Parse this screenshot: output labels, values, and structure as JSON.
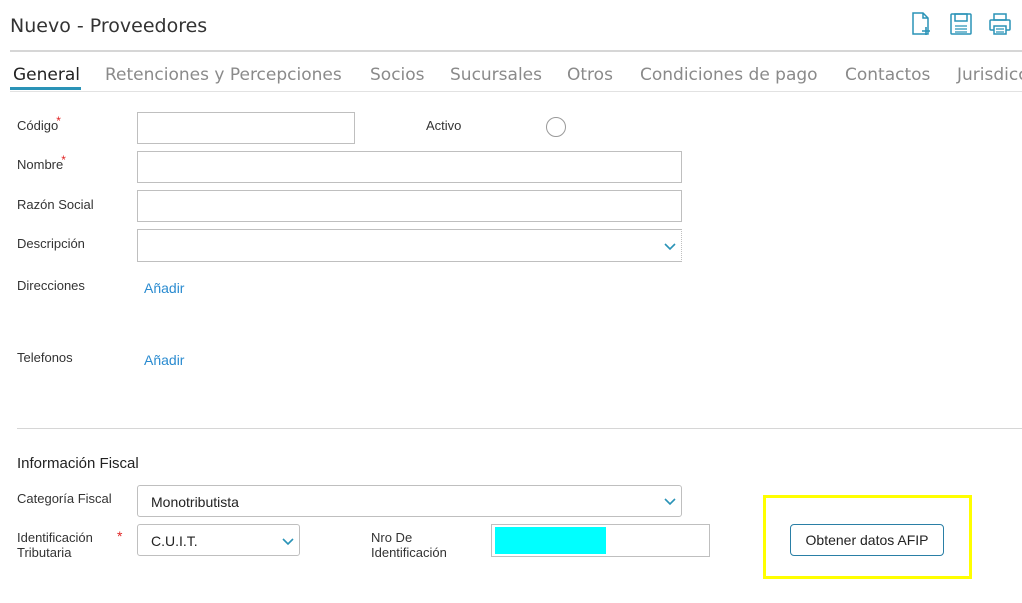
{
  "header": {
    "title": "Nuevo - Proveedores"
  },
  "toolbar": {
    "new_icon": "new-document-icon",
    "save_icon": "save-icon",
    "print_icon": "print-icon"
  },
  "tabs": [
    {
      "label": "General",
      "active": true
    },
    {
      "label": "Retenciones y Percepciones"
    },
    {
      "label": "Socios"
    },
    {
      "label": "Sucursales"
    },
    {
      "label": "Otros"
    },
    {
      "label": "Condiciones de pago"
    },
    {
      "label": "Contactos"
    },
    {
      "label": "Jurisdicciones"
    }
  ],
  "form": {
    "codigo": {
      "label": "Código",
      "required": "*",
      "value": ""
    },
    "activo": {
      "label": "Activo"
    },
    "nombre": {
      "label": "Nombre",
      "required": "*",
      "value": ""
    },
    "razon_social": {
      "label": "Razón Social",
      "value": ""
    },
    "descripcion": {
      "label": "Descripción",
      "value": ""
    },
    "direcciones": {
      "label": "Direcciones",
      "add": "Añadir"
    },
    "telefonos": {
      "label": "Telefonos",
      "add": "Añadir"
    }
  },
  "fiscal": {
    "title": "Información Fiscal",
    "categoria": {
      "label": "Categoría Fiscal",
      "value": "Monotributista"
    },
    "identificacion": {
      "label_line1": "Identificación",
      "label_line2": "Tributaria",
      "required": "*",
      "value": "C.U.I.T."
    },
    "nro": {
      "label_line1": "Nro De",
      "label_line2": "Identificación",
      "value": ""
    },
    "afip_button": "Obtener datos AFIP"
  },
  "colors": {
    "accent": "#2a93b7",
    "link": "#2a8bd0",
    "required": "#e02424",
    "highlight": "#ffff00",
    "redaction": "#00ffff"
  }
}
